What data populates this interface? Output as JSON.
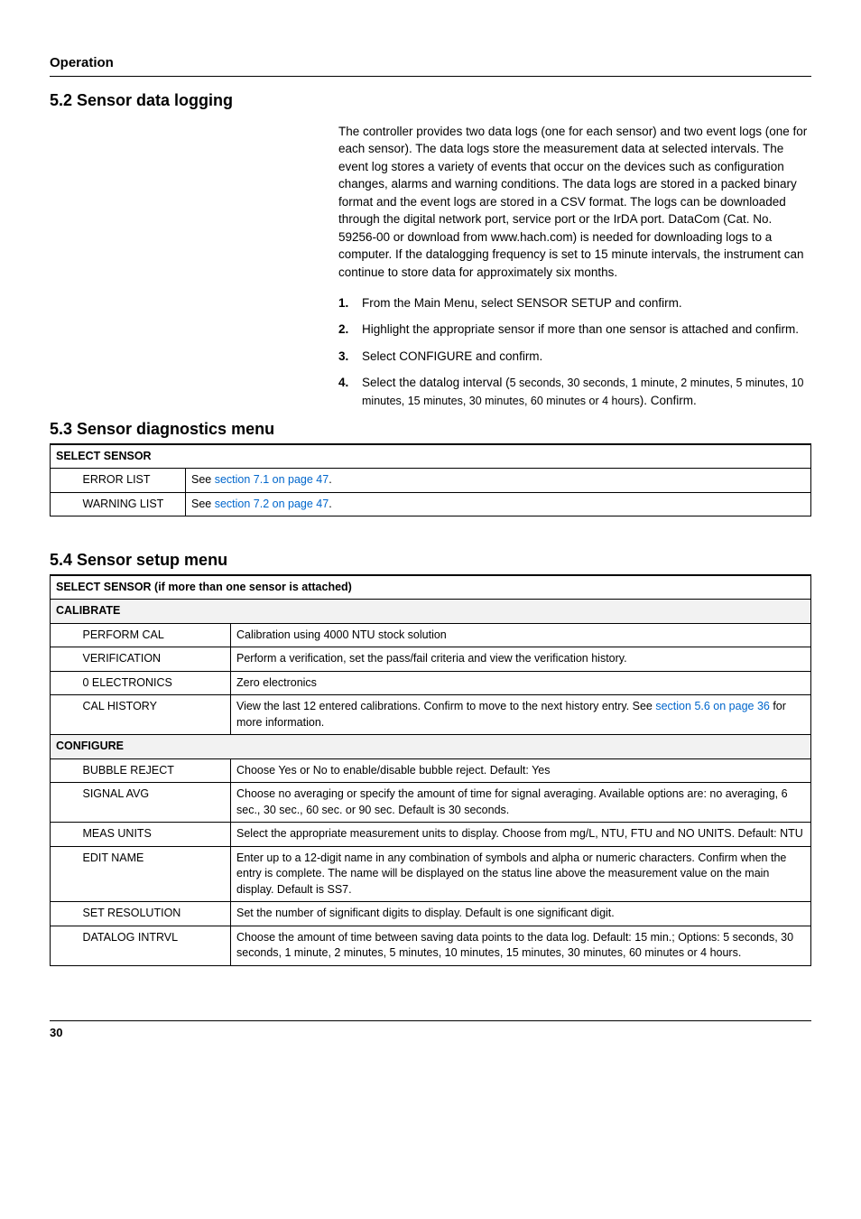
{
  "header": "Operation",
  "section_5_2": {
    "heading": "5.2   Sensor data logging",
    "paragraph": "The controller provides two data logs (one for each sensor) and two event logs (one for each sensor). The data logs store the measurement data at selected intervals. The event log stores a variety of events that occur on the devices such as configuration changes, alarms and warning conditions. The data logs are stored in a packed binary format and the event logs are stored in a CSV format. The logs can be downloaded through the digital network port, service port or the IrDA port. DataCom (Cat. No. 59256-00 or download from www.hach.com) is needed for downloading logs to a computer. If the datalogging frequency is set to 15 minute intervals, the instrument can continue to store data for approximately six months.",
    "steps": [
      {
        "num": "1.",
        "text": "From the Main Menu, select SENSOR SETUP and confirm."
      },
      {
        "num": "2.",
        "text": "Highlight the appropriate sensor if more than one sensor is attached and confirm."
      },
      {
        "num": "3.",
        "text": "Select CONFIGURE and confirm."
      },
      {
        "num": "4.",
        "text_a": "Select the datalog interval (",
        "text_b": "5 seconds, 30 seconds, 1 minute, 2 minutes, 5 minutes, 10 minutes, 15 minutes, 30 minutes, 60 minutes or 4 hours",
        "text_c": "). Confirm."
      }
    ]
  },
  "section_5_3": {
    "heading": "5.3   Sensor diagnostics menu",
    "table": {
      "header": "SELECT SENSOR",
      "rows": [
        {
          "name": "ERROR LIST",
          "desc_a": "See ",
          "link": "section 7.1 on page 47",
          "desc_b": "."
        },
        {
          "name": "WARNING LIST",
          "desc_a": "See ",
          "link": "section 7.2 on page 47",
          "desc_b": "."
        }
      ]
    }
  },
  "section_5_4": {
    "heading": "5.4   Sensor setup menu",
    "table": {
      "header": "SELECT SENSOR (if more than one sensor is attached)",
      "group_calibrate": "CALIBRATE",
      "calibrate_rows": [
        {
          "name": "PERFORM CAL",
          "desc": "Calibration using 4000 NTU stock solution"
        },
        {
          "name": "VERIFICATION",
          "desc": "Perform a verification, set the pass/fail criteria and view the verification history."
        },
        {
          "name": "0 ELECTRONICS",
          "desc": "Zero electronics"
        },
        {
          "name": "CAL HISTORY",
          "desc_a": "View the last 12 entered calibrations. Confirm to move to the next history entry. See ",
          "link": "section 5.6 on page 36",
          "desc_b": " for more information."
        }
      ],
      "group_configure": "CONFIGURE",
      "configure_rows": [
        {
          "name": "BUBBLE REJECT",
          "desc": "Choose Yes or No to enable/disable bubble reject. Default: Yes"
        },
        {
          "name": "SIGNAL AVG",
          "desc": "Choose no averaging or specify the amount of time for signal averaging. Available options are: no averaging, 6 sec., 30 sec., 60 sec. or 90 sec. Default is 30 seconds."
        },
        {
          "name": "MEAS UNITS",
          "desc": "Select the appropriate measurement units to display. Choose from mg/L, NTU, FTU and NO UNITS. Default: NTU"
        },
        {
          "name": "EDIT NAME",
          "desc": "Enter up to a 12-digit name in any combination of symbols and alpha or numeric characters. Confirm when the entry is complete. The name will be displayed on the status line above the measurement value on the main display. Default is SS7."
        },
        {
          "name": "SET RESOLUTION",
          "desc": "Set the number of significant digits to display. Default is one significant digit."
        },
        {
          "name": "DATALOG INTRVL",
          "desc": "Choose the amount of time between saving data points to the data log. Default: 15 min.; Options: 5 seconds, 30 seconds, 1 minute, 2 minutes, 5 minutes, 10 minutes, 15 minutes, 30 minutes, 60 minutes or 4 hours."
        }
      ]
    }
  },
  "page_number": "30"
}
